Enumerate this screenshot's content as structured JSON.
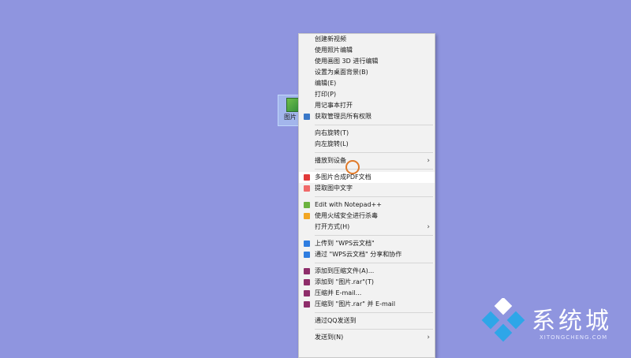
{
  "desktop": {
    "icon_label": "图片"
  },
  "menu": {
    "groups": [
      [
        {
          "label": "创建新视频"
        },
        {
          "label": "使用照片编辑"
        },
        {
          "label": "使用画图 3D 进行编辑"
        },
        {
          "label": "设置为桌面背景(B)"
        },
        {
          "label": "编辑(E)"
        },
        {
          "label": "打印(P)"
        },
        {
          "label": "用记事本打开"
        },
        {
          "label": "获取管理员所有权限",
          "icon": "shield-icon"
        }
      ],
      [
        {
          "label": "向右旋转(T)"
        },
        {
          "label": "向左旋转(L)"
        }
      ],
      [
        {
          "label": "播放到设备",
          "submenu": true
        }
      ],
      [
        {
          "label": "多图片合成PDF文档",
          "icon": "pdf-icon",
          "highlight": true
        },
        {
          "label": "提取图中文字",
          "icon": "text-extract-icon"
        }
      ],
      [
        {
          "label": "Edit with Notepad++",
          "icon": "notepad-icon"
        },
        {
          "label": "使用火绒安全进行杀毒",
          "icon": "huorong-icon"
        },
        {
          "label": "打开方式(H)",
          "submenu": true
        }
      ],
      [
        {
          "label": "上传到 \"WPS云文档\"",
          "icon": "cloud-upload-icon"
        },
        {
          "label": "通过 \"WPS云文档\" 分享和协作",
          "icon": "share-icon"
        }
      ],
      [
        {
          "label": "添加到压缩文件(A)...",
          "icon": "winrar-icon"
        },
        {
          "label": "添加到 \"图片.rar\"(T)",
          "icon": "winrar-icon"
        },
        {
          "label": "压缩并 E-mail...",
          "icon": "winrar-icon"
        },
        {
          "label": "压缩到 \"图片.rar\" 并 E-mail",
          "icon": "winrar-icon"
        }
      ],
      [
        {
          "label": "通过QQ发送到"
        }
      ],
      [
        {
          "label": "发送到(N)",
          "submenu": true
        }
      ]
    ]
  },
  "watermark": {
    "title": "系统城",
    "subtitle": "XITONGCHENG.COM"
  },
  "colors": {
    "desktop_bg": "#8f95df",
    "menu_bg": "#f2f2f2",
    "cursor_ring": "#e07a2a",
    "logo_blue": "#2ea6e8"
  },
  "icon_colors": {
    "shield-icon": "#3a78c8",
    "pdf-icon": "#e23b3b",
    "text-extract-icon": "#f06a6a",
    "notepad-icon": "#6cb33f",
    "huorong-icon": "#f2a623",
    "cloud-upload-icon": "#2f7de0",
    "share-icon": "#2f7de0",
    "winrar-icon": "#8e2d6a"
  }
}
